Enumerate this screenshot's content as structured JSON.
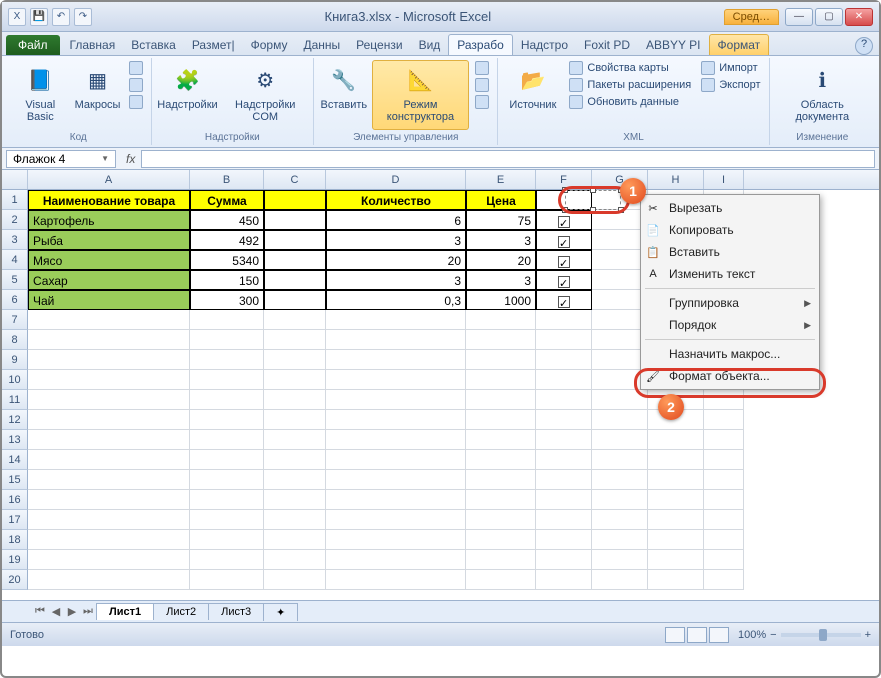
{
  "window": {
    "title": "Книга3.xlsx - Microsoft Excel",
    "tool_context": "Сред…",
    "qat": [
      "X",
      "💾",
      "↶",
      "↷"
    ]
  },
  "tabs": {
    "file": "Файл",
    "items": [
      "Главная",
      "Вставка",
      "Размет|",
      "Форму",
      "Данны",
      "Рецензи",
      "Вид",
      "Разрабо",
      "Надстро",
      "Foxit PD",
      "ABBYY PI"
    ],
    "active_index": 7,
    "format_tab": "Формат"
  },
  "ribbon": {
    "groups": [
      {
        "label": "Код",
        "big": [
          {
            "name": "visual-basic",
            "label": "Visual\nBasic",
            "icon": "📘"
          },
          {
            "name": "macros",
            "label": "Макросы",
            "icon": "▦"
          }
        ],
        "side": [
          {
            "name": "record-macro",
            "icon": "●"
          },
          {
            "name": "relative-refs",
            "icon": "▣"
          },
          {
            "name": "macro-security",
            "icon": "⚠"
          }
        ]
      },
      {
        "label": "Надстройки",
        "big": [
          {
            "name": "addins",
            "label": "Надстройки",
            "icon": "🧩"
          },
          {
            "name": "addins-com",
            "label": "Надстройки\nCOM",
            "icon": "⚙"
          }
        ]
      },
      {
        "label": "Элементы управления",
        "big": [
          {
            "name": "insert-ctrl",
            "label": "Вставить",
            "icon": "🔧"
          },
          {
            "name": "design-mode",
            "label": "Режим\nконструктора",
            "icon": "📐",
            "active": true
          }
        ],
        "side": [
          {
            "name": "properties",
            "icon": "📄"
          },
          {
            "name": "view-code",
            "icon": "📑"
          },
          {
            "name": "run-dialog",
            "icon": "▶"
          }
        ]
      },
      {
        "label": "XML",
        "big": [
          {
            "name": "source",
            "label": "Источник",
            "icon": "📂"
          }
        ],
        "small_items": [
          {
            "name": "map-props",
            "label": "Свойства карты"
          },
          {
            "name": "expansion-packs",
            "label": "Пакеты расширения"
          },
          {
            "name": "refresh-data",
            "label": "Обновить данные"
          }
        ],
        "right_items": [
          {
            "name": "import",
            "label": "Импорт"
          },
          {
            "name": "export",
            "label": "Экспорт"
          }
        ]
      },
      {
        "label": "Изменение",
        "big": [
          {
            "name": "document-panel",
            "label": "Область\nдокумента",
            "icon": "ℹ"
          }
        ]
      }
    ]
  },
  "namebox": "Флажок 4",
  "fx_label": "fx",
  "columns": [
    "A",
    "B",
    "C",
    "D",
    "E",
    "F",
    "G",
    "H",
    "I"
  ],
  "table": {
    "headers": {
      "A": "Наименование товара",
      "B": "Сумма",
      "C": "",
      "D": "Количество",
      "E": "Цена",
      "F": ""
    },
    "rows": [
      {
        "A": "Картофель",
        "B": "450",
        "D": "6",
        "E": "75",
        "F": true
      },
      {
        "A": "Рыба",
        "B": "492",
        "D": "3",
        "E": "3",
        "F": true
      },
      {
        "A": "Мясо",
        "B": "5340",
        "D": "20",
        "E": "20",
        "F": true
      },
      {
        "A": "Сахар",
        "B": "150",
        "D": "3",
        "E": "3",
        "F": true
      },
      {
        "A": "Чай",
        "B": "300",
        "D": "0,3",
        "E": "1000",
        "F": true
      }
    ]
  },
  "context_menu": [
    {
      "label": "Вырезать",
      "icon": "✂"
    },
    {
      "label": "Копировать",
      "icon": "📄"
    },
    {
      "label": "Вставить",
      "icon": "📋"
    },
    {
      "label": "Изменить текст",
      "icon": "A",
      "sep_after": true
    },
    {
      "label": "Группировка",
      "submenu": true
    },
    {
      "label": "Порядок",
      "submenu": true,
      "sep_after": true
    },
    {
      "label": "Назначить макрос..."
    },
    {
      "label": "Формат объекта...",
      "icon": "🖌",
      "highlight": true
    }
  ],
  "sheet_tabs": {
    "items": [
      "Лист1",
      "Лист2",
      "Лист3"
    ],
    "active": 0,
    "add": "+"
  },
  "status": {
    "label": "Готово",
    "zoom": "100%",
    "zoom_minus": "−",
    "zoom_plus": "+"
  },
  "callouts": {
    "1": "1",
    "2": "2"
  }
}
